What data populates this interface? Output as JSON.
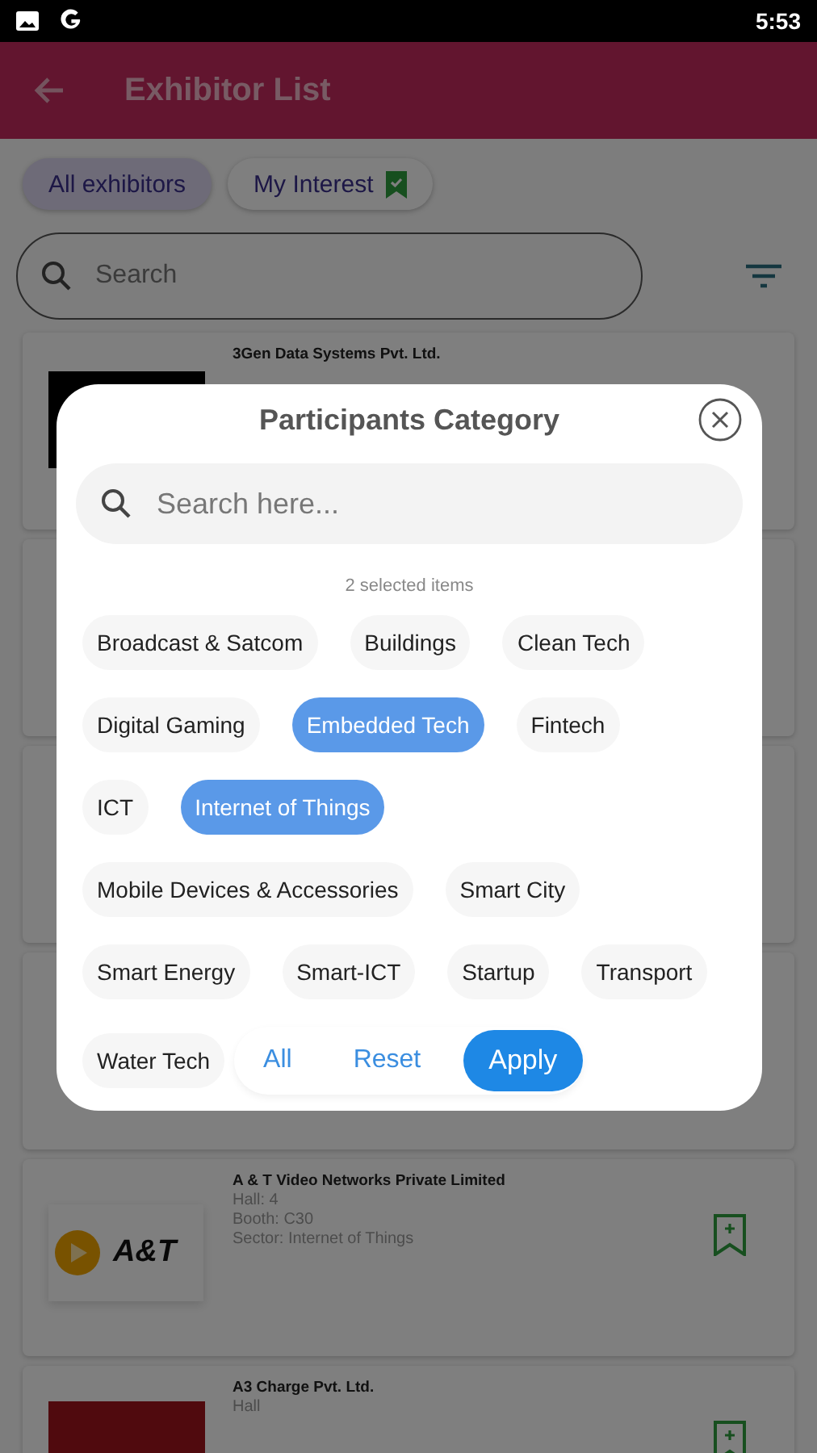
{
  "status_bar": {
    "time": "5:53"
  },
  "app_bar": {
    "title": "Exhibitor List"
  },
  "tabs": [
    {
      "label": "All exhibitors",
      "selected": true
    },
    {
      "label": "My Interest",
      "selected": false
    }
  ],
  "search": {
    "placeholder": "Search"
  },
  "exhibitors": [
    {
      "name": "3Gen Data Systems Pvt. Ltd.",
      "kind": "dark"
    },
    {
      "kind": "blank"
    },
    {
      "kind": "blank"
    },
    {
      "kind": "blank"
    },
    {
      "name": "A & T Video Networks Private Limited",
      "lines": [
        "Hall: 4",
        "Booth: C30",
        "Sector: Internet of Things"
      ],
      "kind": "play",
      "logo_text": "A&T",
      "bookmark": true
    },
    {
      "name": "A3 Charge Pvt. Ltd.",
      "lines": [
        "Hall"
      ],
      "kind": "red",
      "bookmark": true
    }
  ],
  "dialog": {
    "title": "Participants Category",
    "search_placeholder": "Search here...",
    "selected_count": "2 selected items",
    "category_rows": [
      [
        {
          "label": "Broadcast & Satcom",
          "selected": false
        },
        {
          "label": "Buildings",
          "selected": false
        },
        {
          "label": "Clean Tech",
          "selected": false
        }
      ],
      [
        {
          "label": "Digital Gaming",
          "selected": false
        },
        {
          "label": "Embedded Tech",
          "selected": true
        },
        {
          "label": "Fintech",
          "selected": false
        }
      ],
      [
        {
          "label": "ICT",
          "selected": false
        },
        {
          "label": "Internet of Things",
          "selected": true
        }
      ],
      [
        {
          "label": "Mobile Devices & Accessories",
          "selected": false
        },
        {
          "label": "Smart City",
          "selected": false
        }
      ],
      [
        {
          "label": "Smart Energy",
          "selected": false
        },
        {
          "label": "Smart-ICT",
          "selected": false
        },
        {
          "label": "Startup",
          "selected": false
        },
        {
          "label": "Transport",
          "selected": false
        }
      ],
      [
        {
          "label": "Water Tech",
          "selected": false
        }
      ]
    ],
    "actions": [
      {
        "label": "All",
        "kind": "text"
      },
      {
        "label": "Reset",
        "kind": "text"
      },
      {
        "label": "Apply",
        "kind": "filled"
      }
    ]
  }
}
